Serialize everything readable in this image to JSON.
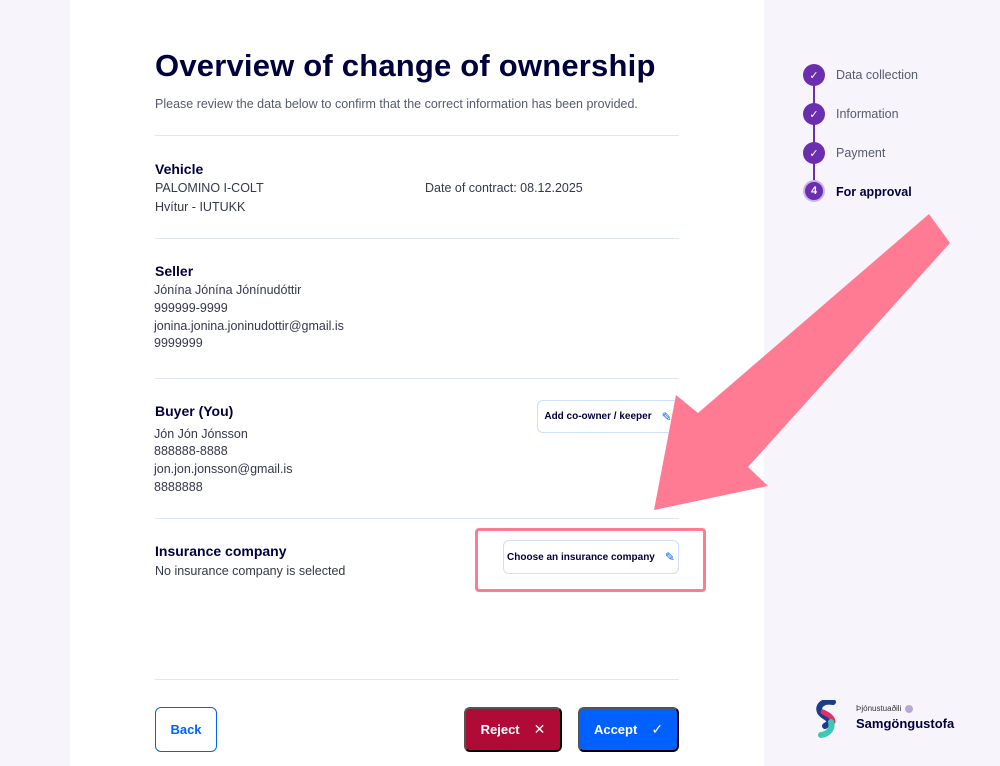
{
  "page": {
    "title": "Overview of change of ownership",
    "subtitle": "Please review the data below to confirm that the correct information has been provided."
  },
  "vehicle": {
    "heading": "Vehicle",
    "name": "PALOMINO I-COLT",
    "color_plate": "Hvítur - IUTUKK",
    "contract_date": "Date of contract: 08.12.2025"
  },
  "seller": {
    "heading": "Seller",
    "name": "Jónína Jónína Jónínudóttir",
    "national_id": "999999-9999",
    "email": "jonina.jonina.joninudottir@gmail.is",
    "phone": "9999999"
  },
  "buyer": {
    "heading": "Buyer (You)",
    "name": "Jón Jón Jónsson",
    "national_id": "888888-8888",
    "email": "jon.jon.jonsson@gmail.is",
    "phone": "8888888",
    "add_coowner_label": "Add co-owner / keeper"
  },
  "insurance": {
    "heading": "Insurance company",
    "status": "No insurance company is selected",
    "choose_label": "Choose an insurance company"
  },
  "actions": {
    "back": "Back",
    "reject": "Reject",
    "accept": "Accept"
  },
  "stepper": {
    "steps": [
      {
        "label": "Data collection",
        "state": "done",
        "marker": "✓"
      },
      {
        "label": "Information",
        "state": "done",
        "marker": "✓"
      },
      {
        "label": "Payment",
        "state": "done",
        "marker": "✓"
      },
      {
        "label": "For approval",
        "state": "active",
        "marker": "4"
      }
    ]
  },
  "provider": {
    "caption": "Þjónustuaðili",
    "name": "Samgöngustofa"
  },
  "colors": {
    "primary": "#0061ff",
    "danger": "#b00b37",
    "step": "#6a2eae",
    "annotation": "#ff7b93"
  },
  "icons": {
    "pencil": "pencil-icon",
    "close": "close-icon",
    "check": "check-icon",
    "arrow": "annotation-arrow-icon"
  }
}
